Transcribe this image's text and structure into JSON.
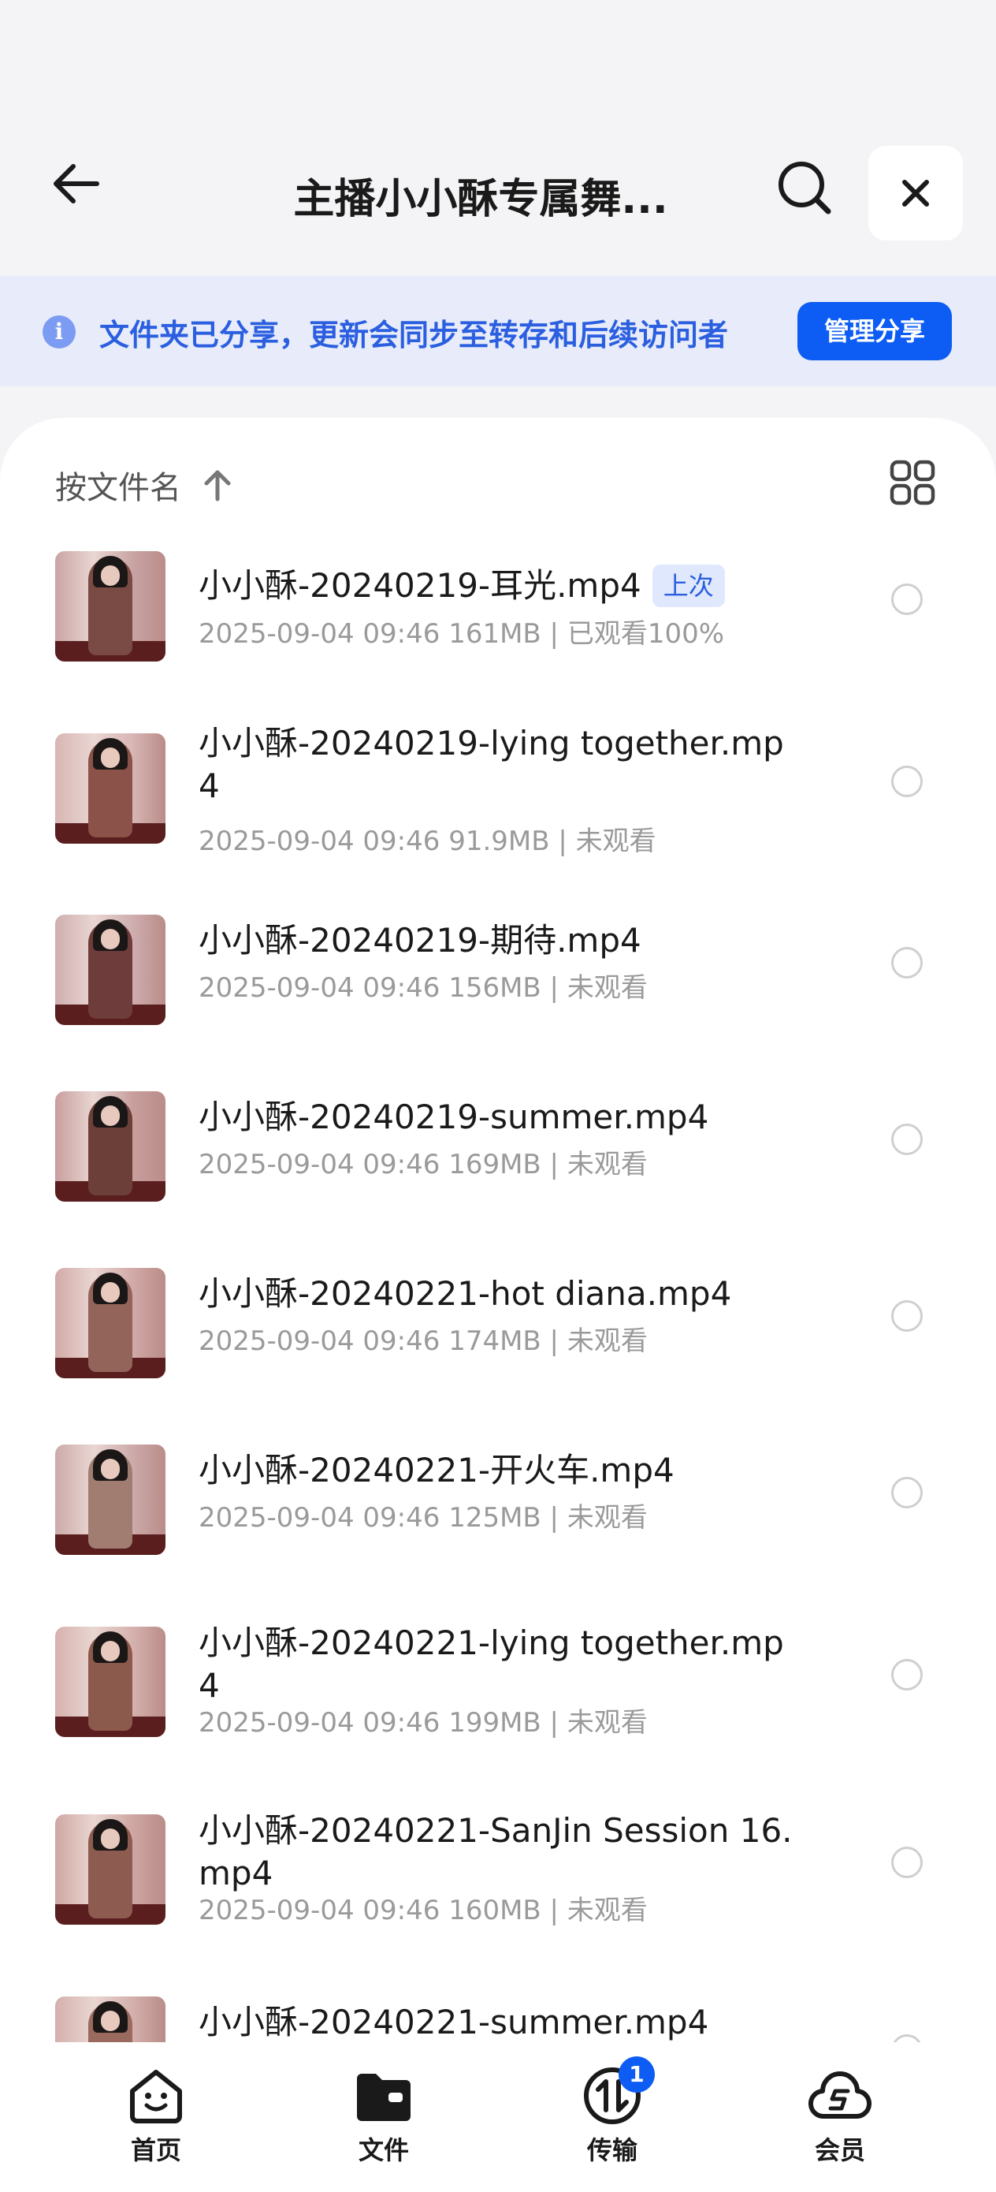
{
  "header": {
    "title": "主播小小酥专属舞..."
  },
  "share_banner": {
    "text": "文件夹已分享，更新会同步至转存和后续访问者",
    "button_label": "管理分享"
  },
  "sort": {
    "label": "按文件名"
  },
  "files": [
    {
      "name": "小小酥-20240219-耳光.mp4",
      "tag": "上次",
      "meta": "2025-09-04 09:46  161MB | 已观看100%"
    },
    {
      "name": "小小酥-20240219-lying together.mp4",
      "tag": "",
      "meta": "2025-09-04 09:46  91.9MB | 未观看"
    },
    {
      "name": "小小酥-20240219-期待.mp4",
      "tag": "",
      "meta": "2025-09-04 09:46  156MB | 未观看"
    },
    {
      "name": "小小酥-20240219-summer.mp4",
      "tag": "",
      "meta": "2025-09-04 09:46  169MB | 未观看"
    },
    {
      "name": "小小酥-20240221-hot diana.mp4",
      "tag": "",
      "meta": "2025-09-04 09:46  174MB | 未观看"
    },
    {
      "name": "小小酥-20240221-开火车.mp4",
      "tag": "",
      "meta": "2025-09-04 09:46  125MB | 未观看"
    },
    {
      "name": "小小酥-20240221-lying together.mp4",
      "tag": "",
      "meta": "2025-09-04 09:46  199MB | 未观看"
    },
    {
      "name": "小小酥-20240221-SanJin Session 16.mp4",
      "tag": "",
      "meta": "2025-09-04 09:46  160MB | 未观看"
    },
    {
      "name": "小小酥-20240221-summer.mp4",
      "tag": "",
      "meta": ""
    }
  ],
  "bottom_nav": [
    {
      "label": "首页",
      "icon": "home-face-icon"
    },
    {
      "label": "文件",
      "icon": "folder-icon"
    },
    {
      "label": "传输",
      "icon": "transfer-icon",
      "badge": "1"
    },
    {
      "label": "会员",
      "icon": "vip-cloud-icon"
    }
  ],
  "colors": {
    "accent": "#0d5cf3",
    "banner_bg": "#e8ecfa",
    "banner_text": "#2b5fe0",
    "background": "#f4f4f6"
  }
}
